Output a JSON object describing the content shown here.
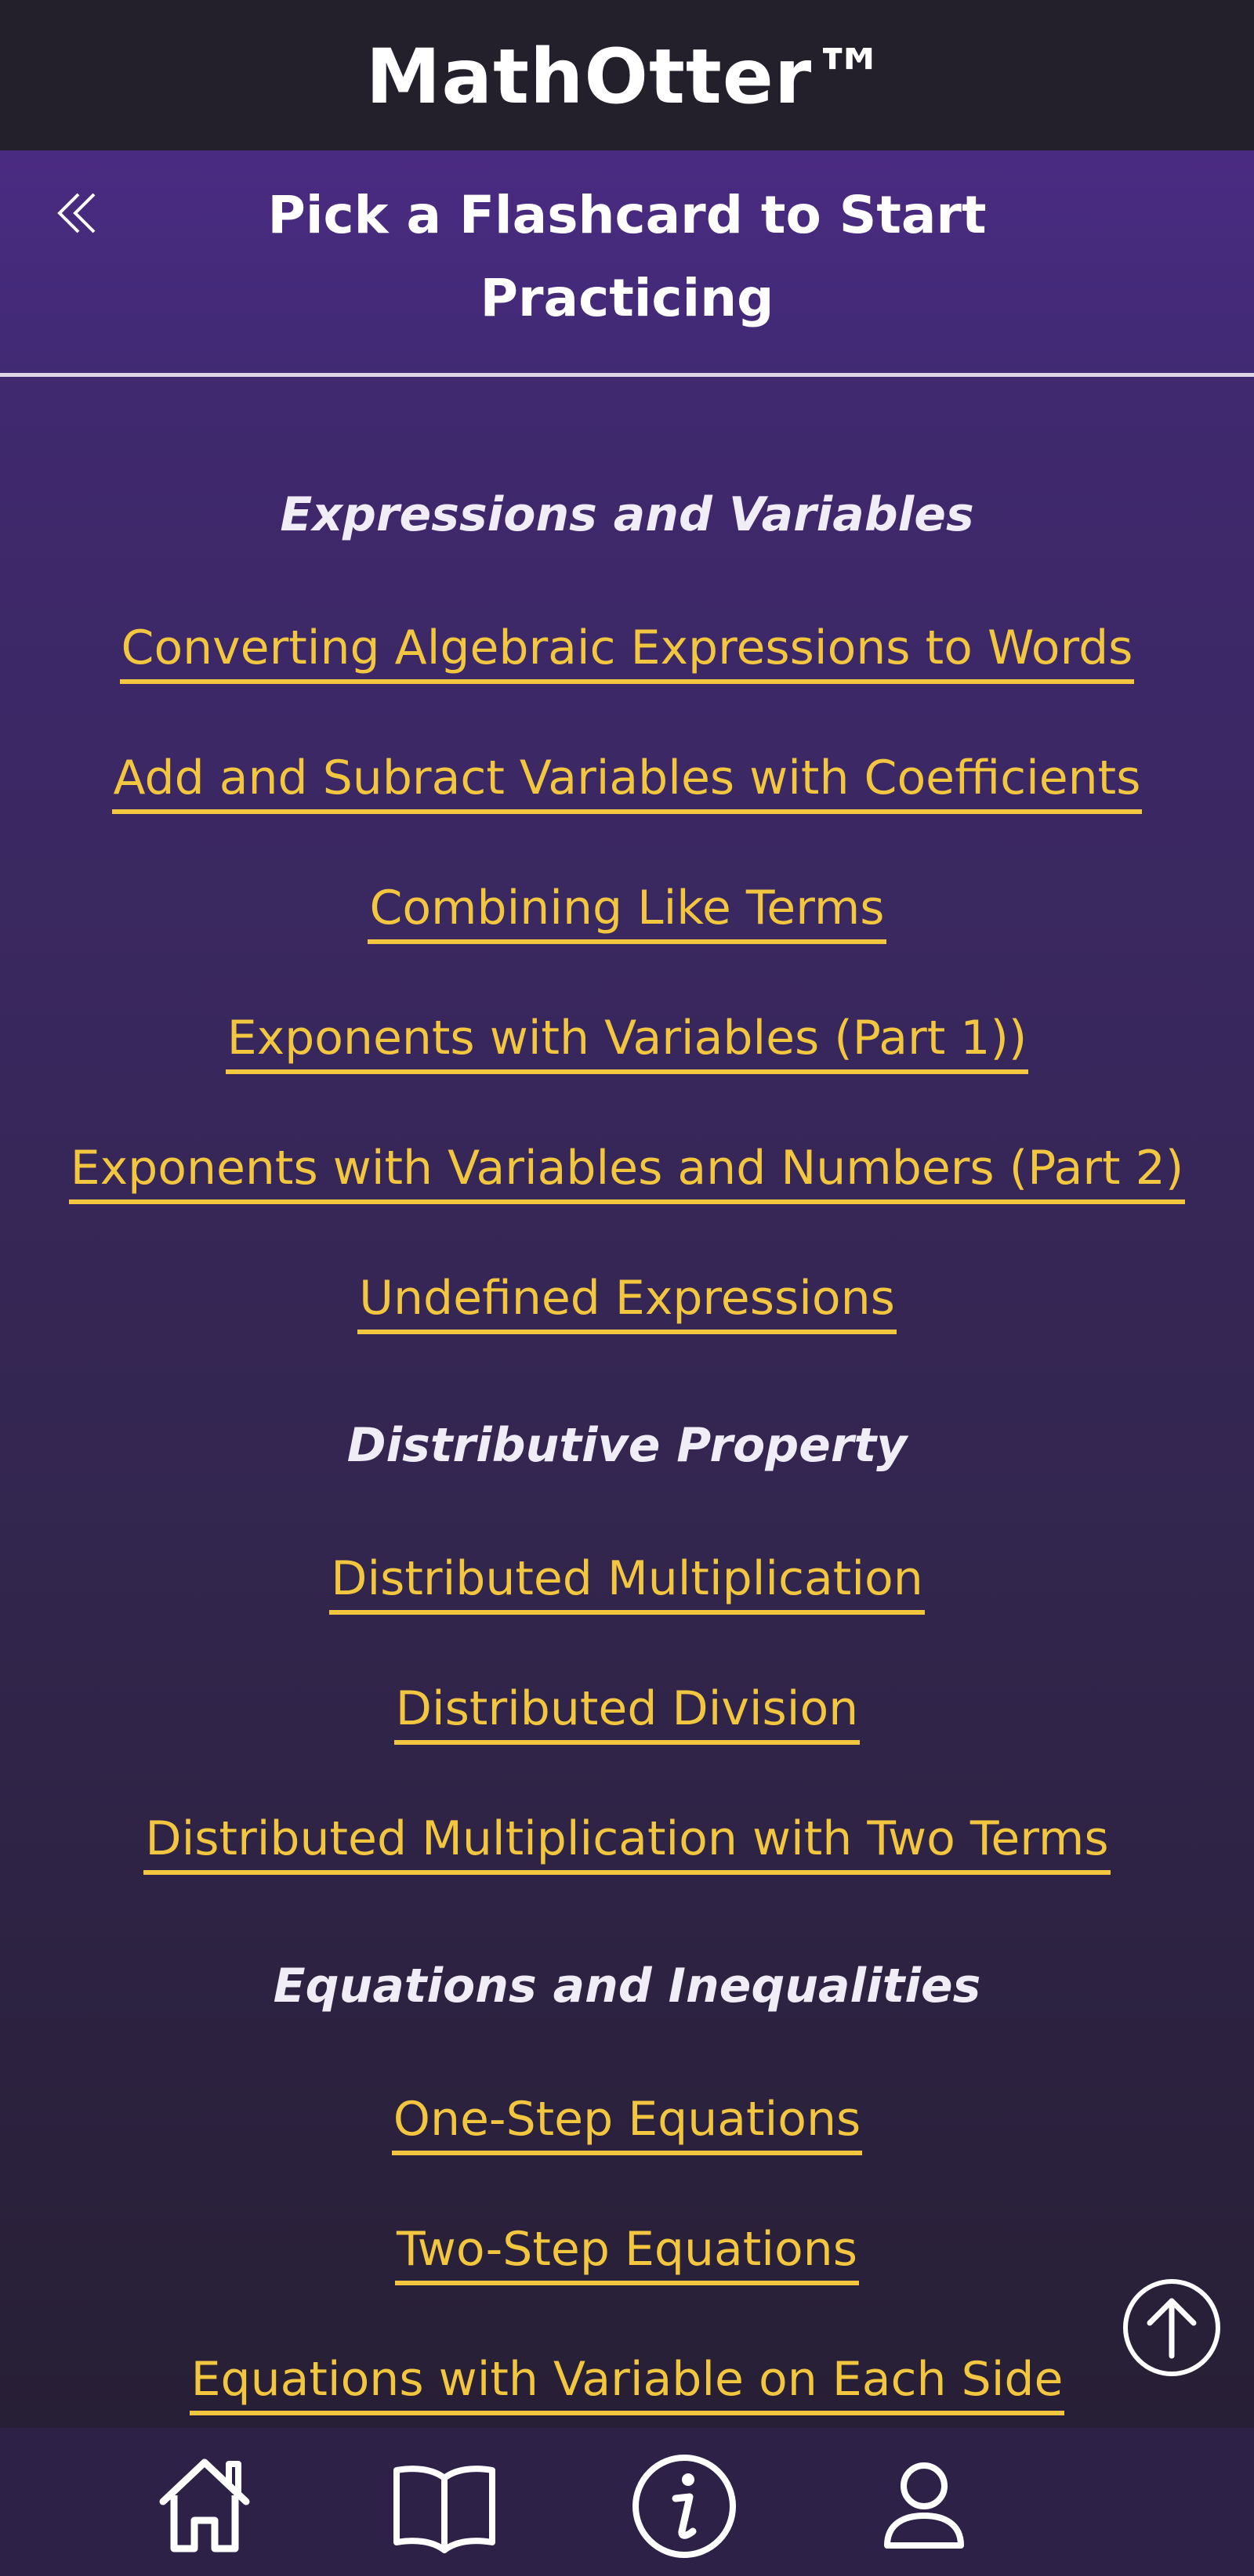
{
  "app": {
    "title": "MathOtter™"
  },
  "page_header": {
    "back_icon": "double-chevron-left-icon",
    "title_line1": "Pick a Flashcard to Start",
    "title_line2": "Practicing"
  },
  "sections": [
    {
      "heading": "Expressions and Variables",
      "items": [
        "Converting Algebraic Expressions to Words",
        "Add and Subract Variables with Coefficients",
        "Combining Like Terms",
        "Exponents with Variables (Part 1))",
        "Exponents with Variables and Numbers (Part 2)",
        "Undefined Expressions"
      ]
    },
    {
      "heading": "Distributive Property",
      "items": [
        "Distributed Multiplication",
        "Distributed Division",
        "Distributed Multiplication with Two Terms"
      ]
    },
    {
      "heading": "Equations and Inequalities",
      "items": [
        "One-Step Equations",
        "Two-Step Equations",
        "Equations with Variable on Each Side"
      ]
    }
  ],
  "scroll_top": {
    "icon": "arrow-up-circle-icon"
  },
  "bottom_nav": [
    {
      "icon": "home-icon"
    },
    {
      "icon": "book-icon"
    },
    {
      "icon": "info-icon"
    },
    {
      "icon": "profile-icon"
    }
  ],
  "colors": {
    "app_header_bg": "#231f2b",
    "page_header_bg": "#4a2b82",
    "link": "#f3c640",
    "heading": "#f1edf6",
    "bottom_nav_bg": "#2e2147"
  }
}
